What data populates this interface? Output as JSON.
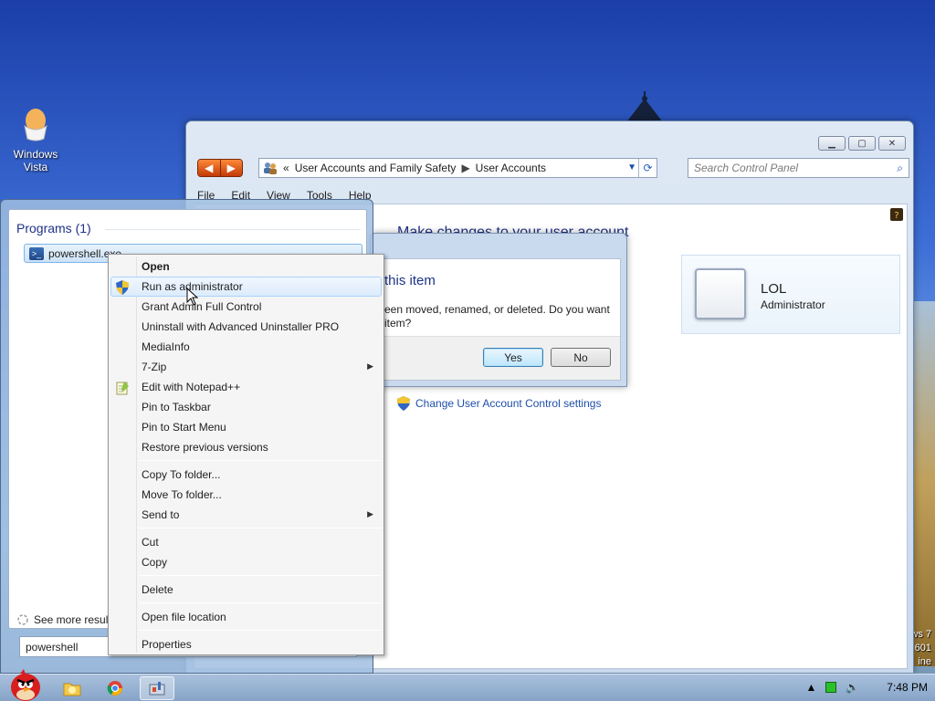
{
  "desktop": {
    "icon_label": "Windows Vista",
    "watermark_lines": [
      "ws 7",
      "601",
      "ine"
    ]
  },
  "control_panel": {
    "breadcrumb_prefix": "«",
    "breadcrumb": [
      "User Accounts and Family Safety",
      "User Accounts"
    ],
    "search_placeholder": "Search Control Panel",
    "menu": [
      "File",
      "Edit",
      "View",
      "Tools",
      "Help"
    ],
    "heading": "Make changes to your user account",
    "user": {
      "name": "LOL",
      "role": "Administrator"
    },
    "uac_link": "Change User Account Control settings"
  },
  "dialog": {
    "title": "this item",
    "message": "een moved, renamed, or deleted. Do you want item?",
    "yes": "Yes",
    "no": "No"
  },
  "start_menu": {
    "programs_header": "Programs (1)",
    "program_item": "powershell.exe",
    "see_more": "See more results",
    "search_value": "powershell"
  },
  "context_menu": {
    "groups": [
      [
        "Open",
        "Run as administrator",
        "Grant Admin Full Control",
        "Uninstall with Advanced Uninstaller PRO",
        "MediaInfo",
        "7-Zip",
        "Edit with Notepad++",
        "Pin to Taskbar",
        "Pin to Start Menu",
        "Restore previous versions"
      ],
      [
        "Copy To folder...",
        "Move To folder...",
        "Send to"
      ],
      [
        "Cut",
        "Copy"
      ],
      [
        "Delete"
      ],
      [
        "Open file location"
      ],
      [
        "Properties"
      ]
    ]
  },
  "taskbar": {
    "clock": "7:48 PM"
  },
  "icons": {
    "shield": "uac-shield-icon",
    "notepad": "notepad-plus-plus-icon",
    "submenu": "chevron-right-icon"
  },
  "colors": {
    "accent_link": "#1e4fa8",
    "heading": "#1e3287",
    "hover_border": "#a8d2fd"
  }
}
